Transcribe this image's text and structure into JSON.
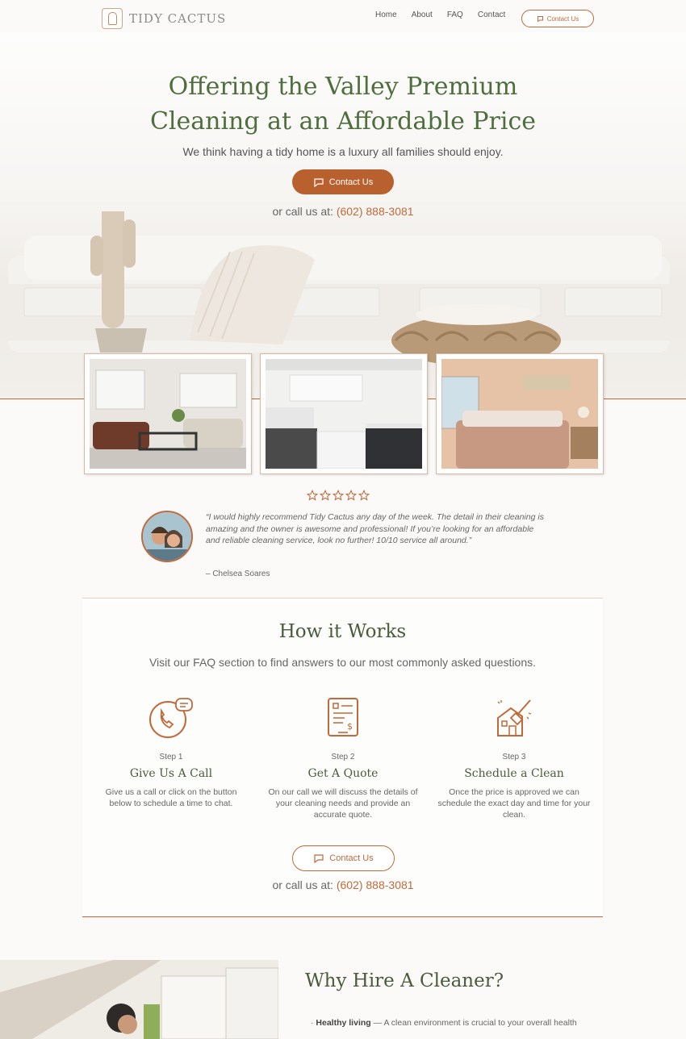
{
  "header": {
    "logo_text": "TIDY CACTUS",
    "nav": [
      "Home",
      "About",
      "FAQ",
      "Contact"
    ],
    "contact_button": "Contact Us"
  },
  "hero": {
    "title_line1": "Offering the Valley Premium",
    "title_line2": "Cleaning at an Affordable Price",
    "subtitle": "We think having a tidy home is a luxury all families should enjoy.",
    "button": "Contact Us",
    "call_prefix": "or call us at:",
    "phone": "(602) 888-3081"
  },
  "gallery": [
    "living-room-photo",
    "kitchen-photo",
    "bedroom-photo"
  ],
  "review": {
    "stars": 5,
    "quote": "“I would highly recommend Tidy Cactus any day of the week. The detail in their cleaning is amazing and the owner is awesome and professional! If you’re looking for an affordable and reliable cleaning service, look no further! 10/10 service all around.”",
    "author": "– Chelsea Soares"
  },
  "how": {
    "title": "How it Works",
    "subtitle": "Visit our FAQ section to find answers to our most commonly asked questions.",
    "steps": [
      {
        "num": "Step 1",
        "title": "Give Us A Call",
        "desc": "Give us a call or click on the button below to schedule a time to chat.",
        "icon": "phone-chat-icon"
      },
      {
        "num": "Step 2",
        "title": "Get A Quote",
        "desc": "On our call we will discuss the details of your cleaning needs and provide an accurate quote.",
        "icon": "quote-document-icon"
      },
      {
        "num": "Step 3",
        "title": "Schedule a Clean",
        "desc": "Once the price is approved we can schedule the exact day and time for your clean.",
        "icon": "house-broom-icon"
      }
    ],
    "button": "Contact Us",
    "call_prefix": "or call us at:",
    "phone": "(602) 888-3081"
  },
  "why": {
    "title": "Why Hire A Cleaner?",
    "item1_bold": "Healthy living",
    "item1_text": " — A clean environment is crucial to your overall health"
  },
  "colors": {
    "accent": "#c0693a",
    "heading_green": "#4f6e3e",
    "text": "#555555"
  }
}
